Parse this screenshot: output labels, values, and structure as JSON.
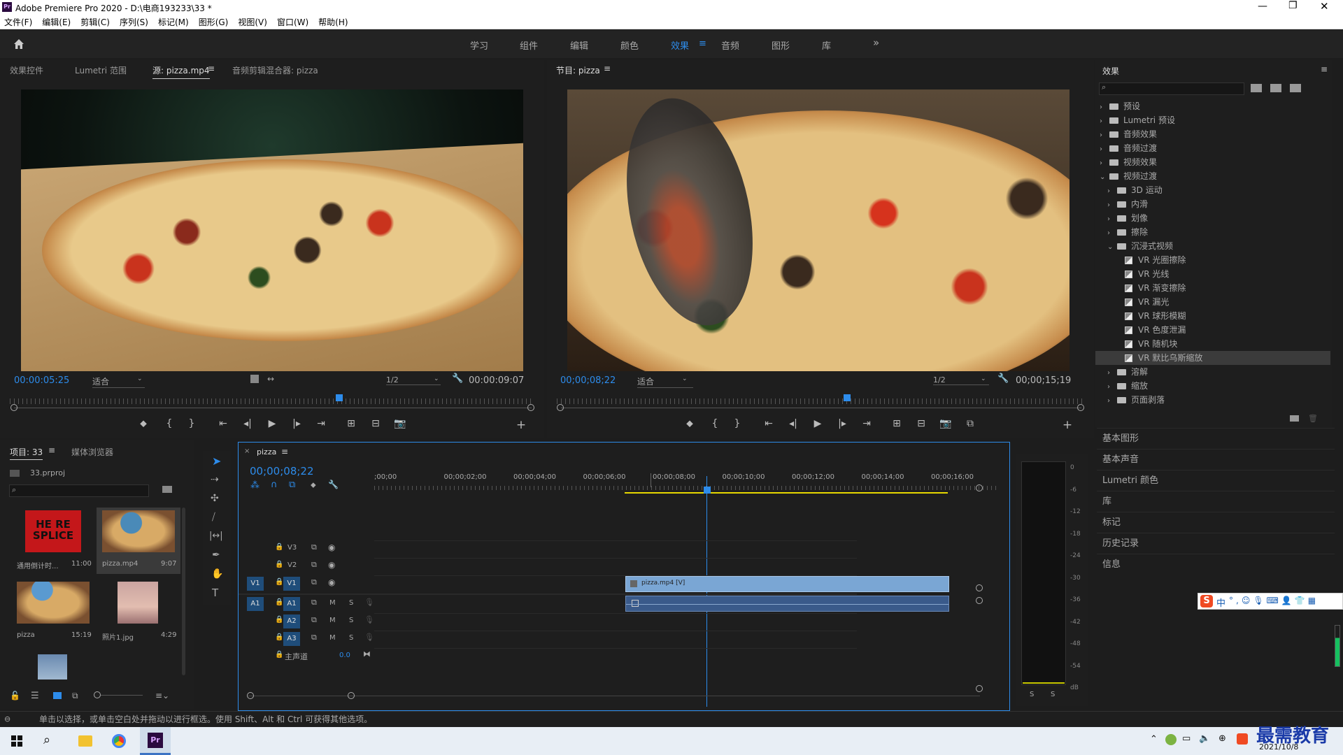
{
  "titlebar": {
    "app_title": "Adobe Premiere Pro 2020 - D:\\电商193233\\33 *"
  },
  "menu": [
    "文件(F)",
    "编辑(E)",
    "剪辑(C)",
    "序列(S)",
    "标记(M)",
    "图形(G)",
    "视图(V)",
    "窗口(W)",
    "帮助(H)"
  ],
  "workspaces": [
    "学习",
    "组件",
    "编辑",
    "颜色",
    "效果",
    "音频",
    "图形",
    "库"
  ],
  "active_workspace": "效果",
  "source_panel": {
    "tabs": [
      "效果控件",
      "Lumetri 范围",
      "源: pizza.mp4",
      "音频剪辑混合器: pizza"
    ],
    "timecode": "00:00:05:25",
    "fit": "适合",
    "resolution": "1/2",
    "duration": "00:00:09:07",
    "playhead_progress": 0.63
  },
  "program_panel": {
    "tab": "节目: pizza",
    "timecode": "00;00;08;22",
    "fit": "适合",
    "resolution": "1/2",
    "duration": "00;00;15;19",
    "playhead_progress": 0.55
  },
  "project_panel": {
    "tabs": [
      "项目: 33",
      "媒体浏览器"
    ],
    "filename": "33.prproj",
    "items": [
      {
        "name": "通用倒计时...",
        "duration": "11:00",
        "thumb_text": "HE RE SPLICE"
      },
      {
        "name": "pizza.mp4",
        "duration": "9:07"
      },
      {
        "name": "pizza",
        "duration": "15:19"
      },
      {
        "name": "照片1.jpg",
        "duration": "4:29"
      }
    ]
  },
  "timeline": {
    "tab": "pizza",
    "timecode": "00;00;08;22",
    "ruler": [
      ";00;00",
      "00;00;02;00",
      "00;00;04;00",
      "00;00;06;00",
      "00;00;08;00",
      "00;00;10;00",
      "00;00;12;00",
      "00;00;14;00",
      "00;00;16;00"
    ],
    "video_tracks": [
      "V3",
      "V2",
      "V1"
    ],
    "audio_tracks": [
      "A1",
      "A2",
      "A3"
    ],
    "master_label": "主声道",
    "master_value": "0.0",
    "clip_label": "pizza.mp4 [V]",
    "track_buttons": [
      "M",
      "S"
    ]
  },
  "effects_panel": {
    "title": "效果",
    "tree": [
      {
        "label": "预设",
        "level": 0,
        "kind": "folder-special"
      },
      {
        "label": "Lumetri 预设",
        "level": 0,
        "kind": "folder-special"
      },
      {
        "label": "音频效果",
        "level": 0,
        "kind": "folder"
      },
      {
        "label": "音频过渡",
        "level": 0,
        "kind": "folder"
      },
      {
        "label": "视频效果",
        "level": 0,
        "kind": "folder"
      },
      {
        "label": "视频过渡",
        "level": 0,
        "kind": "folder",
        "open": true
      },
      {
        "label": "3D 运动",
        "level": 1,
        "kind": "folder"
      },
      {
        "label": "内滑",
        "level": 1,
        "kind": "folder"
      },
      {
        "label": "划像",
        "level": 1,
        "kind": "folder"
      },
      {
        "label": "擦除",
        "level": 1,
        "kind": "folder"
      },
      {
        "label": "沉浸式视频",
        "level": 1,
        "kind": "folder",
        "open": true
      },
      {
        "label": "VR 光圈擦除",
        "level": 2,
        "kind": "fx"
      },
      {
        "label": "VR 光线",
        "level": 2,
        "kind": "fx"
      },
      {
        "label": "VR 渐变擦除",
        "level": 2,
        "kind": "fx"
      },
      {
        "label": "VR 漏光",
        "level": 2,
        "kind": "fx"
      },
      {
        "label": "VR 球形模糊",
        "level": 2,
        "kind": "fx"
      },
      {
        "label": "VR 色度泄漏",
        "level": 2,
        "kind": "fx"
      },
      {
        "label": "VR 随机块",
        "level": 2,
        "kind": "fx"
      },
      {
        "label": "VR 默比乌斯缩放",
        "level": 2,
        "kind": "fx",
        "selected": true
      },
      {
        "label": "溶解",
        "level": 1,
        "kind": "folder"
      },
      {
        "label": "缩放",
        "level": 1,
        "kind": "folder"
      },
      {
        "label": "页面剥落",
        "level": 1,
        "kind": "folder"
      }
    ],
    "side_panels": [
      "基本图形",
      "基本声音",
      "Lumetri 颜色",
      "库",
      "标记",
      "历史记录",
      "信息"
    ]
  },
  "audio_meter": {
    "scale": [
      "0",
      "-6",
      "-12",
      "-18",
      "-24",
      "-30",
      "-36",
      "-42",
      "-48",
      "-54",
      "dB"
    ],
    "buttons": [
      "S",
      "S"
    ]
  },
  "statusbar": {
    "text": "单击以选择，或单击空白处并拖动以进行框选。使用 Shift、Alt 和 Ctrl 可获得其他选项。"
  },
  "ime": {
    "lang": "中"
  },
  "watermark": {
    "text": "最需教育"
  },
  "taskbar": {
    "date": "2021/10/8"
  }
}
